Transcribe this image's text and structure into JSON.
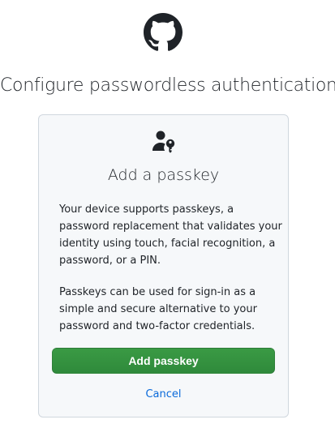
{
  "header": {
    "logo_icon": "github-octocat-icon",
    "title": "Configure passwordless authentication"
  },
  "card": {
    "icon": "person-key-icon",
    "title": "Add a passkey",
    "paragraph1": [
      "Your device supports passkeys, a",
      "password replacement that validates your",
      "identity using touch, facial recognition, a",
      "password, or a PIN."
    ],
    "paragraph2": [
      "Passkeys can be used for sign-in as a",
      "simple and secure alternative to your",
      "password and two-factor credentials."
    ],
    "add_button_label": "Add passkey",
    "cancel_label": "Cancel"
  },
  "colors": {
    "primary_button": "#2f8a3b",
    "link": "#0969da",
    "card_background": "#f6f8fa",
    "card_border": "#d0d7de"
  }
}
